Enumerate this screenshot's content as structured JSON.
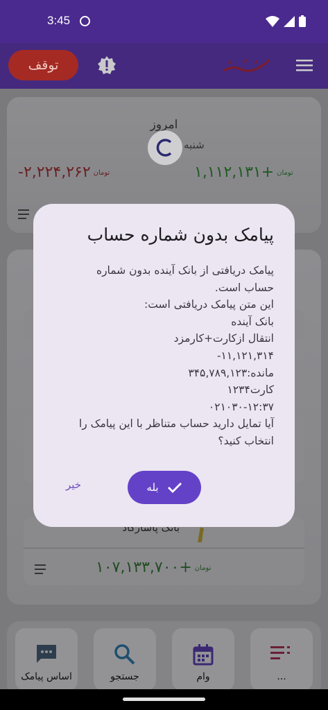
{
  "status_bar": {
    "time": "3:45"
  },
  "app_bar": {
    "stop_label": "توقف",
    "logo_text": "تیر بیر"
  },
  "summary_card": {
    "today_label": "امروز",
    "weekday_label": "شنبه",
    "expense": "-۲,۲۲۴,۲۶۲",
    "income": "+۱,۱۱۲,۱۳۱",
    "currency": "تومان"
  },
  "bank_card": {
    "name": "بانک پاسارگاد",
    "amount": "+۱۰۷,۱۳۳,۷۰۰",
    "currency": "تومان"
  },
  "bottom_nav": {
    "items": [
      {
        "label": "اساس پیامک",
        "icon": "message-icon"
      },
      {
        "label": "جستجو",
        "icon": "search-icon"
      },
      {
        "label": "وام",
        "icon": "calendar-icon"
      },
      {
        "label": "...",
        "icon": "list-icon"
      }
    ]
  },
  "dialog": {
    "title": "پیامک بدون شماره حساب",
    "lines": [
      "پیامک دریافتی از بانک آینده بدون شماره",
      "حساب است.",
      "این متن پیامک دریافتی است:",
      "بانک آینده",
      "انتقال ازکارت+کارمزد",
      "۱۱,۱۲۱,۳۱۴-",
      "مانده:۳۴۵,۷۸۹,۱۲۳",
      "کارت۱۲۳۴",
      "۰۲۱۰۳۰-۱۲:۳۷",
      "آیا تمایل دارید حساب متناظر با این پیامک را",
      "انتخاب کنید؟"
    ],
    "yes_label": "بله",
    "no_label": "خیر"
  },
  "colors": {
    "accent": "#6442c8",
    "app_bar": "#45297f",
    "stop_button": "#a52a24",
    "income": "#1e5a22",
    "expense": "#6a2020"
  }
}
